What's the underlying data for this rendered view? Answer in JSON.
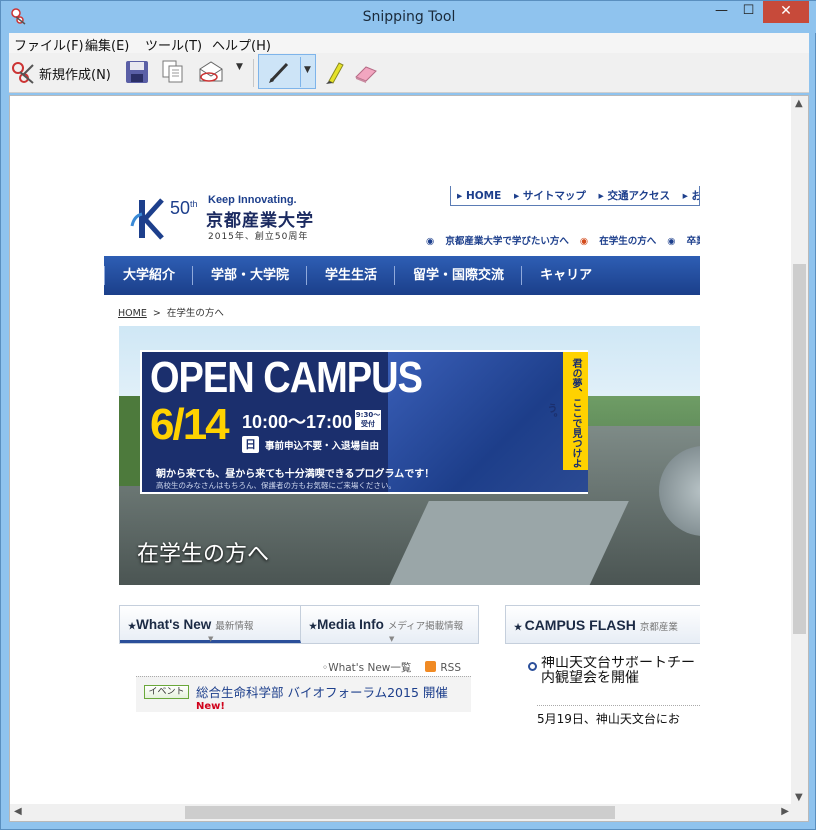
{
  "window": {
    "title": "Snipping Tool",
    "controls": {
      "minimize": "—",
      "maximize": "☐",
      "close": "✕"
    }
  },
  "menubar": {
    "items": [
      {
        "label": "ファイル(F)"
      },
      {
        "label": "編集(E)"
      },
      {
        "label": "ツール(T)"
      },
      {
        "label": "ヘルプ(H)"
      }
    ]
  },
  "toolbar": {
    "new_label": "新規作成(N)",
    "icons": [
      "scissors-icon",
      "save-icon",
      "copy-icon",
      "send-email-icon",
      "pen-icon",
      "highlighter-icon",
      "eraser-icon"
    ]
  },
  "captured_page": {
    "logo": {
      "tagline": "Keep Innovating.",
      "name": "京都産業大学",
      "anniversary": "2015年、創立50周年"
    },
    "top_nav": [
      "HOME",
      "サイトマップ",
      "交通アクセス",
      "お問い"
    ],
    "sub_nav": [
      "京都産業大学で学びたい方へ",
      "在学生の方へ",
      "卒業生"
    ],
    "global_nav": [
      "大学紹介",
      "学部・大学院",
      "学生生活",
      "留学・国際交流",
      "キャリア"
    ],
    "breadcrumb": {
      "home": "HOME",
      "separator": ">",
      "current": "在学生の方へ"
    },
    "hero": {
      "headline": "OPEN CAMPUS",
      "date": "6/14",
      "time": "10:00～17:00",
      "reception": "9:30～受付",
      "day": "日",
      "note": "事前申込不要・入退場自由",
      "line1": "朝から来ても、昼から来ても十分満喫できるプログラムです！",
      "line2": "高校生のみなさんはもちろん、保護者の方もお気軽にご来場ください。",
      "tag": "君の夢、ここで見つけよう。",
      "caption": "在学生の方へ"
    },
    "tabs": [
      {
        "label": "What's New",
        "sub": "最新情報"
      },
      {
        "label": "Media Info",
        "sub": "メディア掲載情報"
      }
    ],
    "news": {
      "list_link": "What's New一覧",
      "rss": "RSS",
      "item": {
        "badge": "イベント",
        "title": "総合生命科学部 バイオフォーラム2015 開催",
        "new_mark": "New!"
      }
    },
    "campus_flash": {
      "label": "CAMPUS FLASH",
      "sub": "京都産業",
      "item_title_line1": "神山天文台サポートチー",
      "item_title_line2": "内観望会を開催",
      "item_date": "5月19日、神山天文台にお"
    }
  },
  "colors": {
    "nav_blue": "#1b3f8a",
    "accent_yellow": "#ffd200",
    "titlebar": "#8fc3ee",
    "close_red": "#c74a3a"
  }
}
